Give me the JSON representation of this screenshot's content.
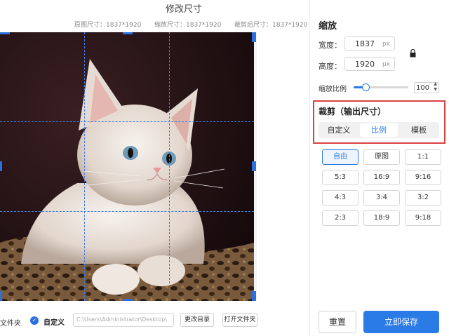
{
  "header": {
    "title": "修改尺寸",
    "original_size": "原图尺寸：1837*1920",
    "scaled_size": "缩放尺寸：1837*1920",
    "cropped_size": "裁剪后尺寸：1837*1920"
  },
  "scale": {
    "section_title": "缩放",
    "width_label": "宽度：",
    "width_value": "1837",
    "height_label": "高度：",
    "height_value": "1920",
    "unit": "px",
    "ratio_label": "缩放比例",
    "ratio_value": "100",
    "slider_fraction": 0.22
  },
  "crop": {
    "section_title": "裁剪（输出尺寸）",
    "tabs": [
      {
        "label": "自定义"
      },
      {
        "label": "比例"
      },
      {
        "label": "模板"
      }
    ],
    "active_tab": "比例",
    "ratios": [
      "自由",
      "原图",
      "1:1",
      "5:3",
      "16:9",
      "9:16",
      "4:3",
      "3:4",
      "3:2",
      "2:3",
      "18:9",
      "9:18"
    ],
    "active_ratio": "自由"
  },
  "footer": {
    "folder_partial": "文件夹",
    "custom_label": "自定义",
    "path_value": "C:\\Users\\Administrator\\Desktop\\",
    "change_dir": "更改目录",
    "open_folder": "打开文件夹",
    "reset": "重置",
    "save": "立即保存"
  },
  "colors": {
    "accent": "#2b7be6",
    "highlight_box": "#d9433f"
  }
}
